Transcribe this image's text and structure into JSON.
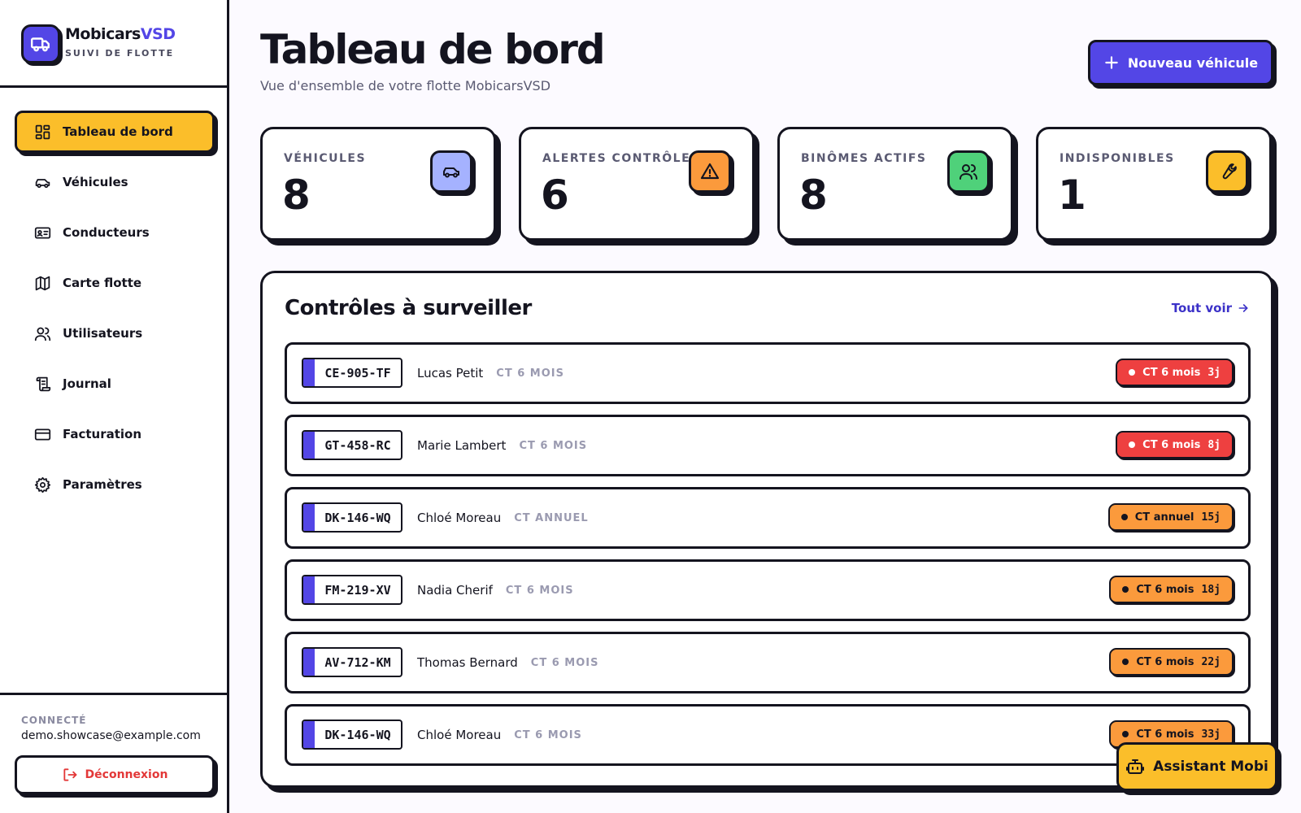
{
  "brand": {
    "name_main": "Mobicars",
    "name_accent": "VSD",
    "subtitle": "SUIVI DE FLOTTE"
  },
  "nav": {
    "items": [
      {
        "label": "Tableau de bord",
        "icon": "dashboard-icon",
        "active": true
      },
      {
        "label": "Véhicules",
        "icon": "car-icon"
      },
      {
        "label": "Conducteurs",
        "icon": "id-card-icon"
      },
      {
        "label": "Carte flotte",
        "icon": "map-icon"
      },
      {
        "label": "Utilisateurs",
        "icon": "users-icon"
      },
      {
        "label": "Journal",
        "icon": "scroll-icon"
      },
      {
        "label": "Facturation",
        "icon": "credit-card-icon"
      },
      {
        "label": "Paramètres",
        "icon": "gear-icon"
      }
    ]
  },
  "footer": {
    "connected_label": "CONNECTÉ",
    "email": "demo.showcase@example.com",
    "logout_label": "Déconnexion"
  },
  "header": {
    "title": "Tableau de bord",
    "subtitle": "Vue d'ensemble de votre flotte MobicarsVSD",
    "new_button": "Nouveau véhicule"
  },
  "stats": [
    {
      "label": "VÉHICULES",
      "value": "8",
      "icon": "car-icon",
      "color": "#a5b2ff"
    },
    {
      "label": "ALERTES CONTRÔLE",
      "value": "6",
      "icon": "warning-icon",
      "color": "#fb9a3c"
    },
    {
      "label": "BINÔMES ACTIFS",
      "value": "8",
      "icon": "users-icon",
      "color": "#4fd17a"
    },
    {
      "label": "INDISPONIBLES",
      "value": "1",
      "icon": "wrench-icon",
      "color": "#fbbe2a"
    }
  ],
  "panel": {
    "title": "Contrôles à surveiller",
    "see_all": "Tout voir",
    "rows": [
      {
        "plate": "CE-905-TF",
        "driver": "Lucas Petit",
        "type": "CT 6 MOIS",
        "badge": "CT 6 mois",
        "days": "3j",
        "level": "red"
      },
      {
        "plate": "GT-458-RC",
        "driver": "Marie Lambert",
        "type": "CT 6 MOIS",
        "badge": "CT 6 mois",
        "days": "8j",
        "level": "red"
      },
      {
        "plate": "DK-146-WQ",
        "driver": "Chloé Moreau",
        "type": "CT ANNUEL",
        "badge": "CT annuel",
        "days": "15j",
        "level": "orange"
      },
      {
        "plate": "FM-219-XV",
        "driver": "Nadia Cherif",
        "type": "CT 6 MOIS",
        "badge": "CT 6 mois",
        "days": "18j",
        "level": "orange"
      },
      {
        "plate": "AV-712-KM",
        "driver": "Thomas Bernard",
        "type": "CT 6 MOIS",
        "badge": "CT 6 mois",
        "days": "22j",
        "level": "orange"
      },
      {
        "plate": "DK-146-WQ",
        "driver": "Chloé Moreau",
        "type": "CT 6 MOIS",
        "badge": "CT 6 mois",
        "days": "33j",
        "level": "orange"
      }
    ]
  },
  "assistant": {
    "label": "Assistant Mobi",
    "icon": "robot-icon"
  },
  "colors": {
    "accent": "#5346e6",
    "yellow": "#fbbe2a",
    "red": "#ee4040",
    "orange": "#fb9a3c",
    "ink": "#14141f"
  }
}
